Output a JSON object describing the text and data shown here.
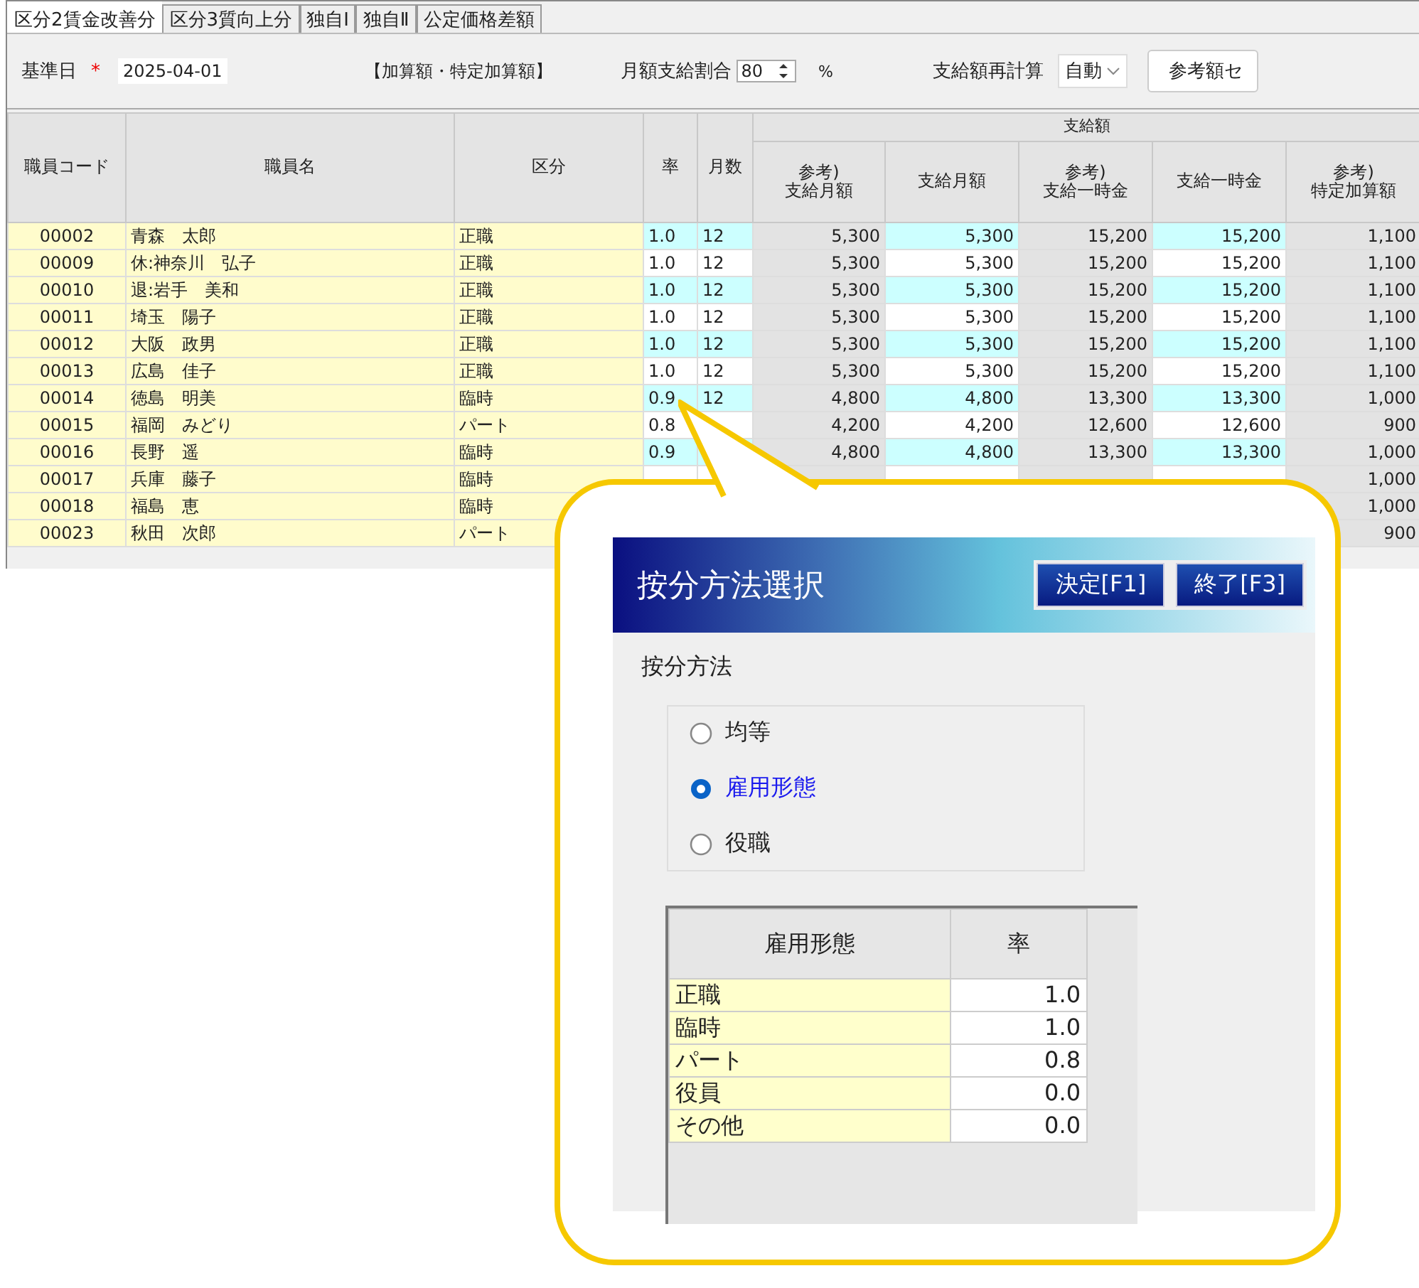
{
  "tabs": [
    {
      "label": "区分2賃金改善分",
      "selected": true
    },
    {
      "label": "区分3質向上分",
      "selected": false
    },
    {
      "label": "独自Ⅰ",
      "selected": false
    },
    {
      "label": "独自Ⅱ",
      "selected": false
    },
    {
      "label": "公定価格差額",
      "selected": false
    }
  ],
  "toolbar": {
    "base_date_label": "基準日",
    "required_mark": "*",
    "base_date": "2025-04-01",
    "section_label": "【加算額・特定加算額】",
    "ratio_label": "月額支給割合",
    "ratio_value": "80",
    "ratio_unit": "%",
    "recalc_label": "支給額再計算",
    "recalc_value": "自動",
    "ref_button": "参考額セ"
  },
  "table": {
    "columns": [
      "職員コード",
      "職員名",
      "区分",
      "率",
      "月数"
    ],
    "group_header": "支給額",
    "money_columns": [
      "参考)\n支給月額",
      "支給月額",
      "参考)\n支給一時金",
      "支給一時金",
      "参考)\n特定加算額"
    ],
    "rows": [
      {
        "code": "00002",
        "name": "青森　太郎",
        "category": "正職",
        "rate": "1.0",
        "months": "12",
        "ref_monthly": "5,300",
        "monthly": "5,300",
        "ref_lump": "15,200",
        "lump": "15,200",
        "ref_special": "1,100"
      },
      {
        "code": "00009",
        "name": "休:神奈川　弘子",
        "category": "正職",
        "rate": "1.0",
        "months": "12",
        "ref_monthly": "5,300",
        "monthly": "5,300",
        "ref_lump": "15,200",
        "lump": "15,200",
        "ref_special": "1,100"
      },
      {
        "code": "00010",
        "name": "退:岩手　美和",
        "category": "正職",
        "rate": "1.0",
        "months": "12",
        "ref_monthly": "5,300",
        "monthly": "5,300",
        "ref_lump": "15,200",
        "lump": "15,200",
        "ref_special": "1,100"
      },
      {
        "code": "00011",
        "name": "埼玉　陽子",
        "category": "正職",
        "rate": "1.0",
        "months": "12",
        "ref_monthly": "5,300",
        "monthly": "5,300",
        "ref_lump": "15,200",
        "lump": "15,200",
        "ref_special": "1,100"
      },
      {
        "code": "00012",
        "name": "大阪　政男",
        "category": "正職",
        "rate": "1.0",
        "months": "12",
        "ref_monthly": "5,300",
        "monthly": "5,300",
        "ref_lump": "15,200",
        "lump": "15,200",
        "ref_special": "1,100"
      },
      {
        "code": "00013",
        "name": "広島　佳子",
        "category": "正職",
        "rate": "1.0",
        "months": "12",
        "ref_monthly": "5,300",
        "monthly": "5,300",
        "ref_lump": "15,200",
        "lump": "15,200",
        "ref_special": "1,100"
      },
      {
        "code": "00014",
        "name": "徳島　明美",
        "category": "臨時",
        "rate": "0.9",
        "months": "12",
        "ref_monthly": "4,800",
        "monthly": "4,800",
        "ref_lump": "13,300",
        "lump": "13,300",
        "ref_special": "1,000"
      },
      {
        "code": "00015",
        "name": "福岡　みどり",
        "category": "パート",
        "rate": "0.8",
        "ref_monthly": "4,200",
        "monthly": "4,200",
        "ref_lump": "12,600",
        "lump": "12,600",
        "ref_special": "900"
      },
      {
        "code": "00016",
        "name": "長野　遥",
        "category": "臨時",
        "rate": "0.9",
        "ref_monthly": "4,800",
        "monthly": "4,800",
        "ref_lump": "13,300",
        "lump": "13,300",
        "ref_special": "1,000"
      },
      {
        "code": "00017",
        "name": "兵庫　藤子",
        "category": "臨時",
        "ref_special": "1,000"
      },
      {
        "code": "00018",
        "name": "福島　恵",
        "category": "臨時",
        "ref_special": "1,000"
      },
      {
        "code": "00023",
        "name": "秋田　次郎",
        "category": "パート",
        "ref_special": "900"
      }
    ]
  },
  "dialog": {
    "title": "按分方法選択",
    "buttons": [
      "決定[F1]",
      "終了[F3]"
    ],
    "method_label": "按分方法",
    "options": [
      {
        "label": "均等",
        "selected": false
      },
      {
        "label": "雇用形態",
        "selected": true
      },
      {
        "label": "役職",
        "selected": false
      }
    ],
    "rate_table": {
      "columns": [
        "雇用形態",
        "率"
      ],
      "rows": [
        {
          "type": "正職",
          "rate": "1.0"
        },
        {
          "type": "臨時",
          "rate": "1.0"
        },
        {
          "type": "パート",
          "rate": "0.8"
        },
        {
          "type": "役員",
          "rate": "0.0"
        },
        {
          "type": "その他",
          "rate": "0.0"
        }
      ]
    }
  }
}
